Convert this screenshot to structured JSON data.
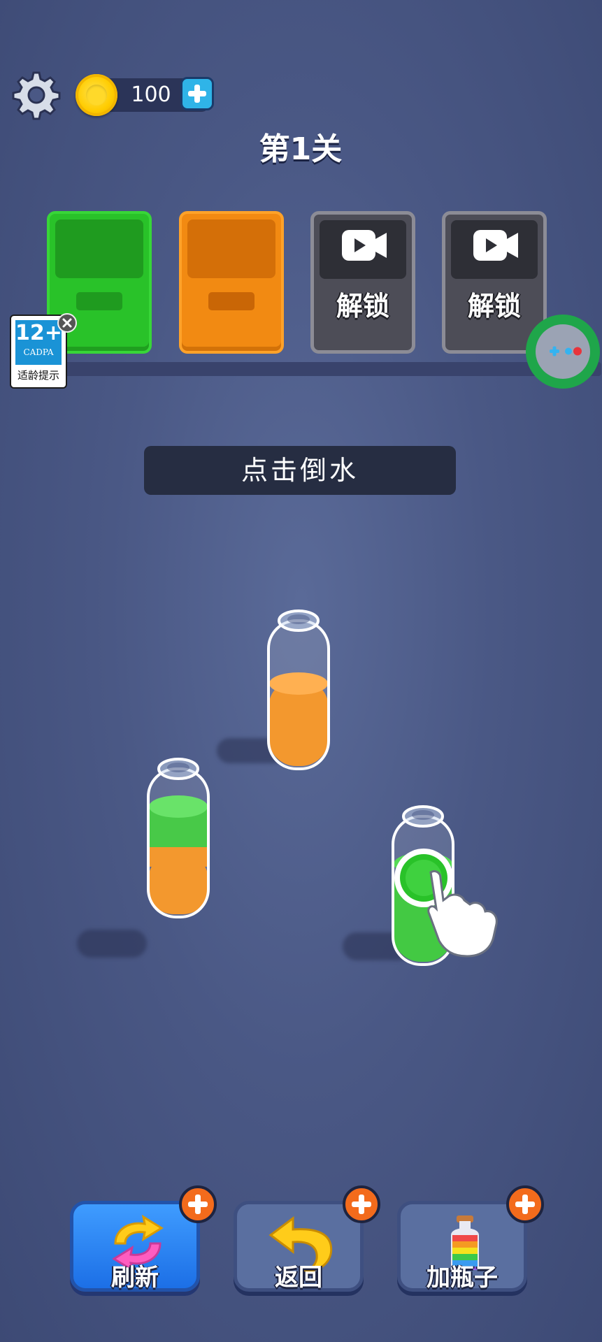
{
  "header": {
    "coins": "100",
    "level_title": "第1关"
  },
  "boxes": [
    {
      "color": "green",
      "hex": "#29c229",
      "state": "open"
    },
    {
      "color": "orange",
      "hex": "#f28a12",
      "state": "open"
    },
    {
      "state": "locked",
      "label": "解锁"
    },
    {
      "state": "locked",
      "label": "解锁"
    }
  ],
  "age_badge": {
    "rating": "12+",
    "org": "CADPA",
    "tip": "适龄提示"
  },
  "hint": "点击倒水",
  "bottles": [
    {
      "id": "left",
      "layers": [
        "#f28a12",
        "#3ed13e"
      ]
    },
    {
      "id": "middle",
      "layers": [
        "#f28a12"
      ]
    },
    {
      "id": "right",
      "layers": [
        "#29c229",
        "#29c229"
      ],
      "highlighted": true
    }
  ],
  "buttons": {
    "refresh": "刷新",
    "undo": "返回",
    "add_bottle": "加瓶子"
  },
  "colors": {
    "background": "#4a5885",
    "green": "#29c229",
    "orange": "#f28a12",
    "accent_plus": "#f36b1c"
  }
}
